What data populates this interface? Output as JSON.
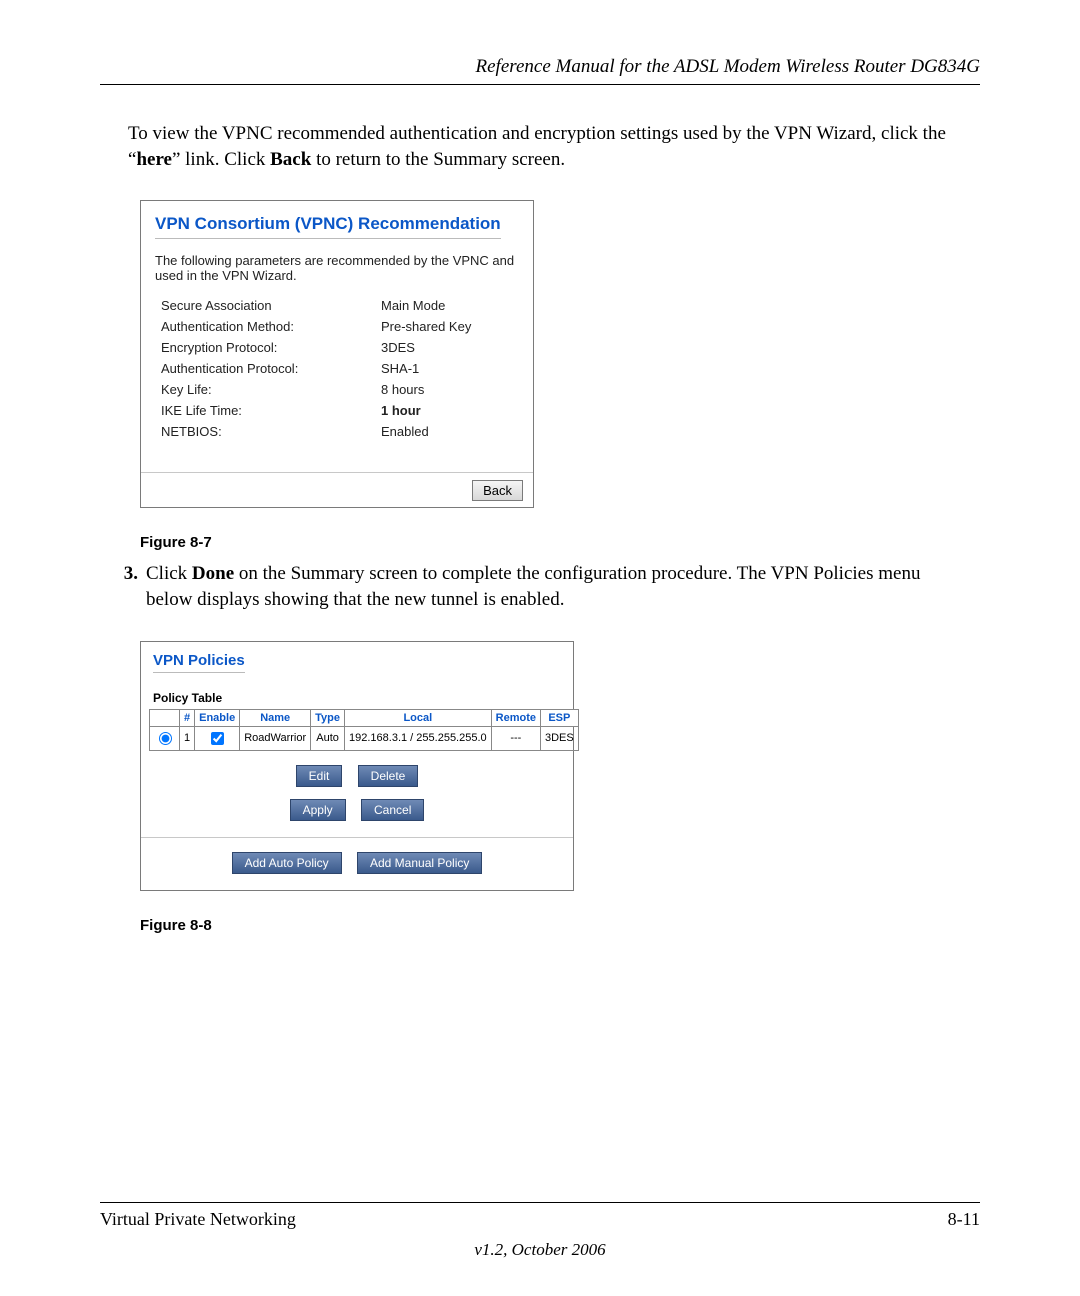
{
  "header": {
    "title": "Reference Manual for the ADSL Modem Wireless Router DG834G"
  },
  "intro": {
    "part1": "To view the VPNC recommended authentication and encryption settings used by the VPN Wizard, click the “",
    "here": "here",
    "part2": "” link. Click ",
    "back": "Back",
    "part3": " to return to the Summary screen."
  },
  "vpnc_panel": {
    "title": "VPN Consortium (VPNC) Recommendation",
    "desc": "The following parameters are recommended by the VPNC and used in the VPN Wizard.",
    "rows": [
      {
        "label": "Secure Association",
        "value": "Main Mode"
      },
      {
        "label": "Authentication Method:",
        "value": "Pre-shared Key"
      },
      {
        "label": "Encryption Protocol:",
        "value": "3DES"
      },
      {
        "label": "Authentication Protocol:",
        "value": "SHA-1"
      },
      {
        "label": "Key Life:",
        "value": "8 hours"
      },
      {
        "label": "IKE Life Time:",
        "value": "1 hour",
        "bold": true
      },
      {
        "label": "NETBIOS:",
        "value": "Enabled"
      }
    ],
    "back_button": "Back"
  },
  "figure_caption_1": "Figure 8-7",
  "step3": {
    "marker": "3.",
    "text_part1": "Click ",
    "done": "Done",
    "text_part2": " on the Summary screen to complete the configuration procedure. The VPN Policies menu below displays showing that the new tunnel is enabled."
  },
  "policies_panel": {
    "title": "VPN Policies",
    "subtitle": "Policy Table",
    "headers": {
      "sel": "",
      "num": "#",
      "enable": "Enable",
      "name": "Name",
      "type": "Type",
      "local": "Local",
      "remote": "Remote",
      "esp": "ESP"
    },
    "row": {
      "num": "1",
      "name": "RoadWarrior",
      "type": "Auto",
      "local": "192.168.3.1 / 255.255.255.0",
      "remote": "---",
      "esp": "3DES"
    },
    "buttons": {
      "edit": "Edit",
      "delete": "Delete",
      "apply": "Apply",
      "cancel": "Cancel",
      "add_auto": "Add Auto Policy",
      "add_manual": "Add Manual Policy"
    }
  },
  "figure_caption_2": "Figure 8-8",
  "footer": {
    "left": "Virtual Private Networking",
    "right": "8-11",
    "version": "v1.2, October 2006"
  }
}
